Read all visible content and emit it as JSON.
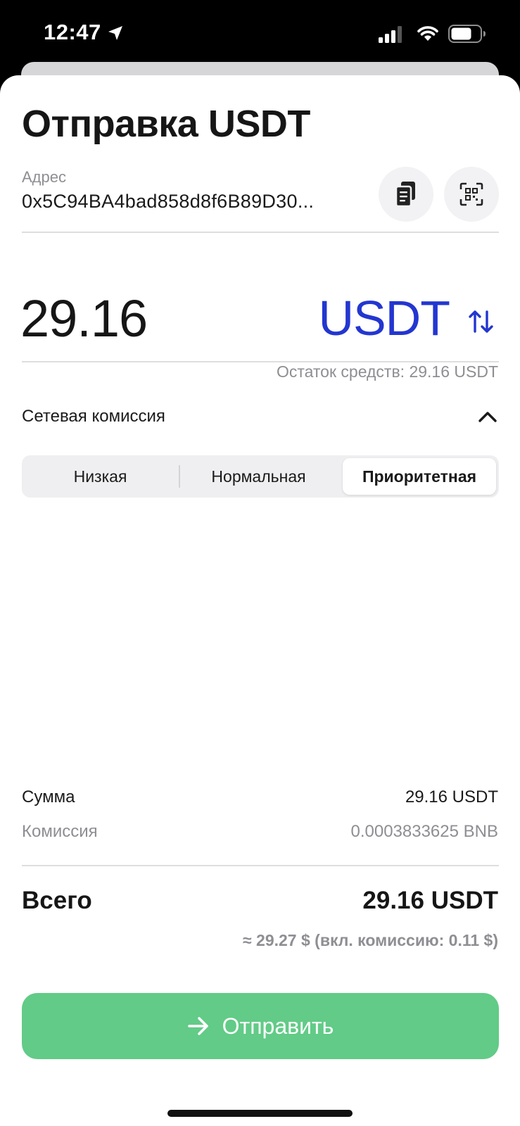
{
  "status_bar": {
    "time": "12:47"
  },
  "sheet": {
    "title": "Отправка USDT",
    "address": {
      "label": "Адрес",
      "value": "0x5C94BA4bad858d8f6B89D30..."
    },
    "amount": {
      "value": "29.16",
      "currency": "USDT",
      "balance": "Остаток средств: 29.16 USDT"
    },
    "fee": {
      "label": "Сетевая комиссия",
      "options": [
        "Низкая",
        "Нормальная",
        "Приоритетная"
      ],
      "selected": "Приоритетная"
    },
    "summary": {
      "sum_label": "Сумма",
      "sum_value": "29.16 USDT",
      "commission_label": "Комиссия",
      "commission_value": "0.0003833625 BNB",
      "total_label": "Всего",
      "total_value": "29.16 USDT",
      "approx": "≈ 29.27 $ (вкл. комиссию: 0.11 $)"
    },
    "send_button": "Отправить"
  },
  "colors": {
    "accent_blue": "#2336d0",
    "send_green": "#62cb87",
    "muted_gray": "#8e8e93"
  },
  "icons": [
    "location-arrow-icon",
    "signal-icon",
    "wifi-icon",
    "battery-icon",
    "paste-icon",
    "qr-scan-icon",
    "swap-icon",
    "chevron-up-icon",
    "arrow-right-icon"
  ]
}
